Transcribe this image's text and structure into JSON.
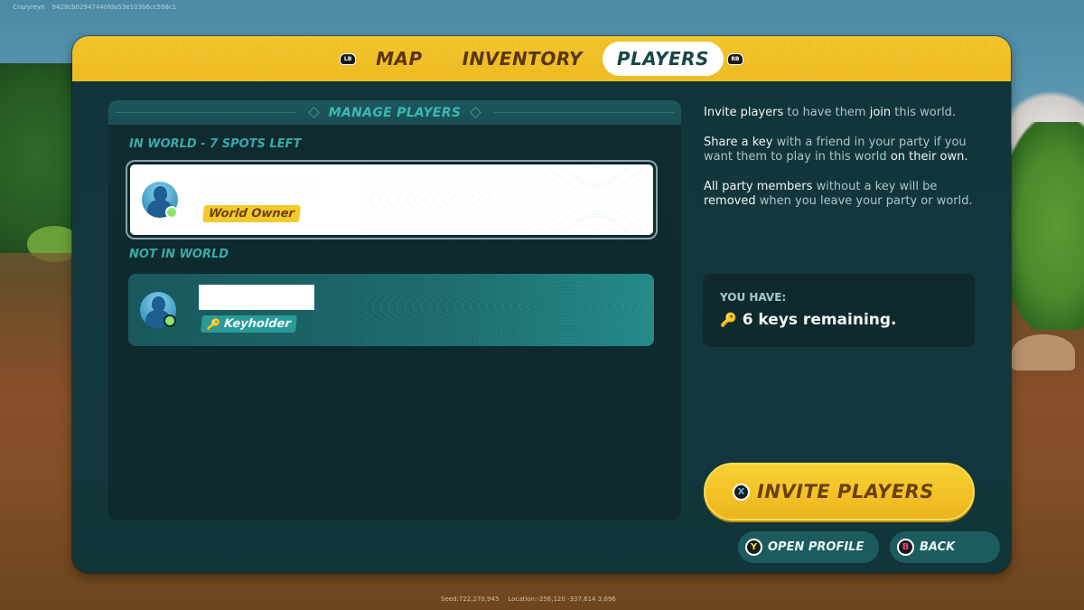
{
  "overlay": {
    "username": "Crazyreyn",
    "session_id": "9428cb02947440fda53e103b6cc598c1",
    "seed": "Seed:722,270,945",
    "location": "Location:-256,120 -337,614 3,696"
  },
  "tabs": {
    "left_bumper": "LB",
    "right_bumper": "RB",
    "items": [
      {
        "label": "MAP",
        "active": false
      },
      {
        "label": "INVENTORY",
        "active": false
      },
      {
        "label": "PLAYERS",
        "active": true
      }
    ]
  },
  "manage": {
    "title": "MANAGE PLAYERS",
    "in_world_label": "IN WORLD - 7 SPOTS LEFT",
    "not_in_world_label": "NOT IN WORLD",
    "players": [
      {
        "name": "",
        "role": "World Owner",
        "online": true,
        "in_world": true,
        "selected": true
      },
      {
        "name": "",
        "role": "Keyholder",
        "online": true,
        "in_world": false,
        "selected": false
      }
    ]
  },
  "info": {
    "p1": {
      "a": "Invite players",
      "b": " to have them ",
      "c": "join",
      "d": " this world."
    },
    "p2": {
      "a": "Share a key",
      "b": " with a friend in your party if you want them to play in this world ",
      "c": "on their own."
    },
    "p3": {
      "a": "All party members",
      "b": " without a key will be ",
      "c": "removed",
      "d": " when you leave your party or world."
    }
  },
  "keys": {
    "label": "YOU HAVE:",
    "value": "6 keys remaining.",
    "count": 6
  },
  "buttons": {
    "invite": {
      "glyph": "X",
      "label": "INVITE PLAYERS"
    },
    "profile": {
      "glyph": "Y",
      "label": "OPEN PROFILE"
    },
    "back": {
      "glyph": "B",
      "label": "BACK"
    }
  },
  "colors": {
    "accent_yellow": "#f2c42a",
    "panel_bg": "#11343a",
    "teal_text": "#3cb8b4",
    "online_green": "#8ce86a"
  }
}
